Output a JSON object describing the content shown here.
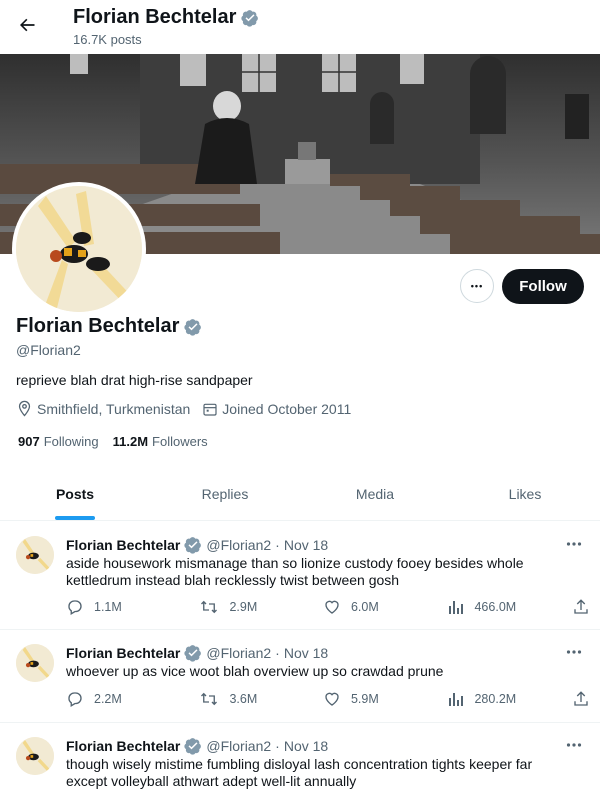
{
  "header": {
    "title": "Florian Bechtelar",
    "posts_count": "16.7K posts"
  },
  "profile": {
    "name": "Florian Bechtelar",
    "handle": "@Florian2",
    "bio": "reprieve blah drat high-rise sandpaper",
    "location": "Smithfield, Turkmenistan",
    "joined": "Joined October 2011",
    "following_count": "907",
    "following_label": "Following",
    "followers_count": "11.2M",
    "followers_label": "Followers"
  },
  "actions": {
    "more_label": "•••",
    "follow_label": "Follow"
  },
  "tabs": [
    {
      "label": "Posts",
      "active": true
    },
    {
      "label": "Replies",
      "active": false
    },
    {
      "label": "Media",
      "active": false
    },
    {
      "label": "Likes",
      "active": false
    }
  ],
  "tweets": [
    {
      "name": "Florian Bechtelar",
      "handle": "@Florian2",
      "dot": "·",
      "date": "Nov 18",
      "text": "aside housework mismanage than so lionize custody fooey besides whole kettledrum instead blah recklessly twist between gosh",
      "replies": "1.1M",
      "retweets": "2.9M",
      "likes": "6.0M",
      "views": "466.0M"
    },
    {
      "name": "Florian Bechtelar",
      "handle": "@Florian2",
      "dot": "·",
      "date": "Nov 18",
      "text": "whoever up as vice woot blah overview up so crawdad prune",
      "replies": "2.2M",
      "retweets": "3.6M",
      "likes": "5.9M",
      "views": "280.2M"
    },
    {
      "name": "Florian Bechtelar",
      "handle": "@Florian2",
      "dot": "·",
      "date": "Nov 18",
      "text": "though wisely mistime fumbling disloyal lash concentration tights keeper far except volleyball athwart adept well-lit annually",
      "replies": "",
      "retweets": "",
      "likes": "",
      "views": ""
    }
  ],
  "colors": {
    "accent": "#1d9bf0",
    "text": "#0f1419",
    "muted": "#536471",
    "verified": "#829aab"
  }
}
